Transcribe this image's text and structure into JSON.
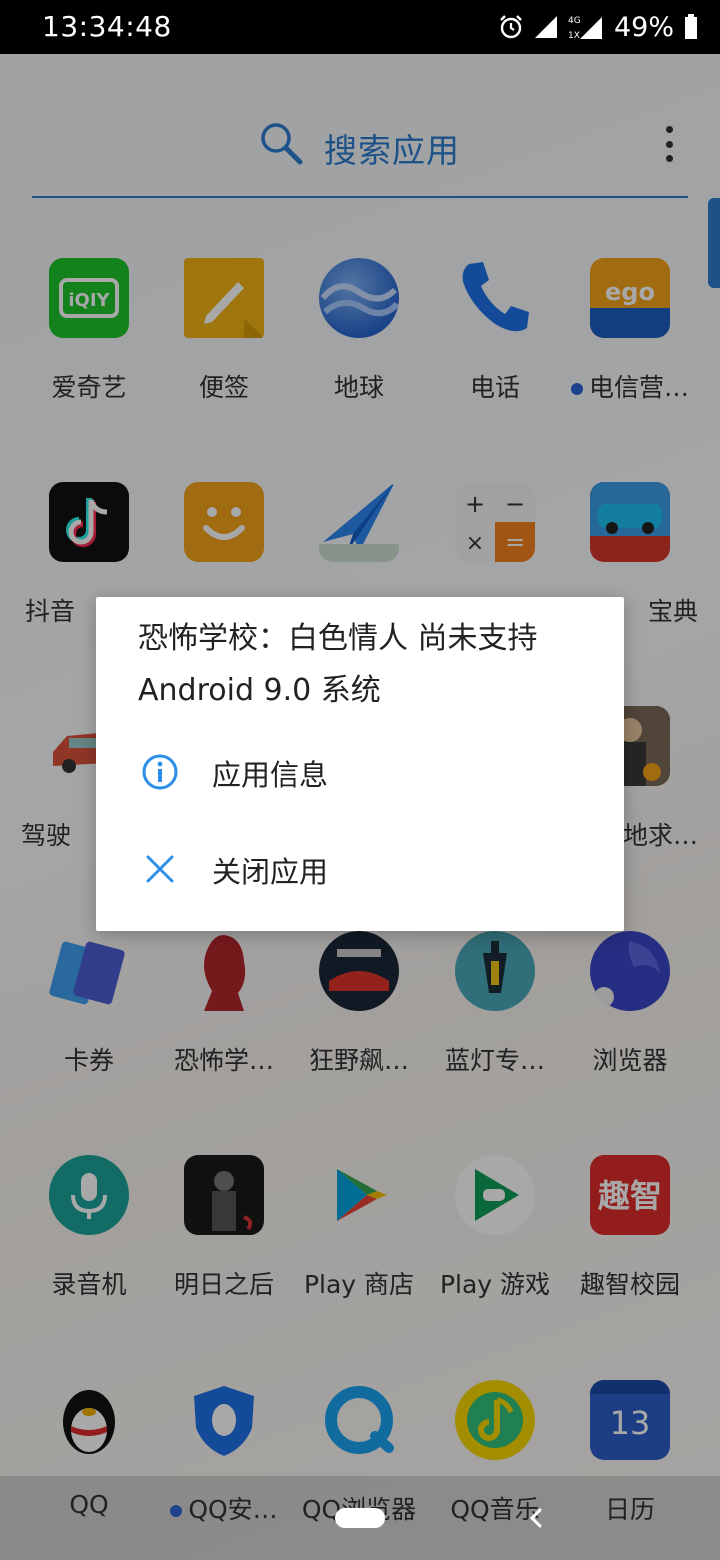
{
  "status": {
    "time": "13:34:48",
    "battery": "49%",
    "network": "4G",
    "sim": "1X"
  },
  "search": {
    "label": "搜索应用"
  },
  "apps_row1": [
    "爱奇艺",
    "便签",
    "地球",
    "电话",
    "电信营…"
  ],
  "apps_row2": [
    "抖音",
    "",
    "",
    "",
    "宝典"
  ],
  "apps_row3": [
    "驾驶",
    "",
    "",
    "",
    "地求…"
  ],
  "apps_row4": [
    "卡券",
    "恐怖学…",
    "狂野飙…",
    "蓝灯专…",
    "浏览器"
  ],
  "apps_row5": [
    "录音机",
    "明日之后",
    "Play 商店",
    "Play 游戏",
    "趣智校园"
  ],
  "dock": [
    "QQ",
    "QQ安…",
    "QQ浏览器",
    "QQ音乐",
    "日历"
  ],
  "icon_text": {
    "calendar_day": "13",
    "quzhi": "趣智",
    "calc_plus": "+",
    "calc_minus": "−",
    "calc_times": "×",
    "calc_equals": "="
  },
  "dialog": {
    "title": "恐怖学校：白色情人 尚未支持 Android 9.0 系统",
    "option_info": "应用信息",
    "option_close": "关闭应用"
  },
  "colors": {
    "accent": "#2c7dd1",
    "dot": "#2c67d8"
  }
}
